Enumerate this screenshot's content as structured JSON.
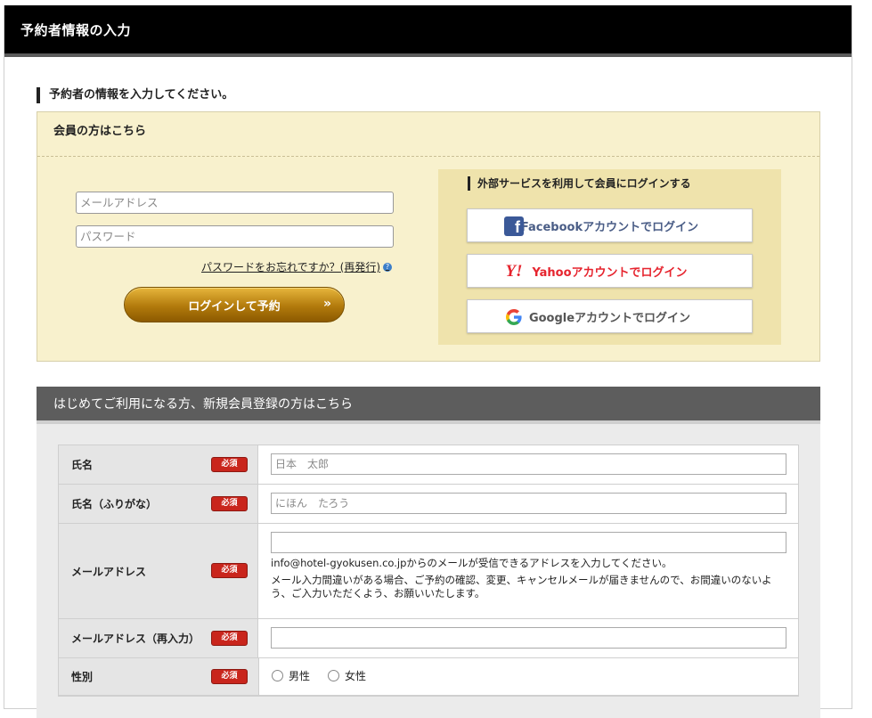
{
  "header": {
    "title": "予約者情報の入力"
  },
  "intro": {
    "heading": "予約者の情報を入力してください。"
  },
  "member_login": {
    "title": "会員の方はこちら",
    "email_placeholder": "メールアドレス",
    "password_placeholder": "パスワード",
    "forgot_link": "パスワードをお忘れですか？(再発行)",
    "help_icon": "?",
    "login_button": "ログインして予約",
    "login_button_icon": "»"
  },
  "external_login": {
    "title": "外部サービスを利用して会員にログインする",
    "facebook": {
      "label": "Facebookアカウントでログイン",
      "icon": "facebook-icon",
      "icon_text": "f",
      "color": "#4a5d86"
    },
    "yahoo": {
      "label": "Yahooアカウントでログイン",
      "icon": "yahoo-icon",
      "icon_text": "Y!",
      "color": "#e6242e"
    },
    "google": {
      "label": "Googleアカウントでログイン",
      "icon": "google-icon",
      "color": "#555555"
    }
  },
  "registration": {
    "title": "はじめてご利用になる方、新規会員登録の方はこちら",
    "required_badge": "必須",
    "fields": {
      "name": {
        "label": "氏名",
        "placeholder": "日本　太郎"
      },
      "name_kana": {
        "label": "氏名（ふりがな）",
        "placeholder": "にほん　たろう"
      },
      "email": {
        "label": "メールアドレス",
        "note1": "info@hotel-gyokusen.co.jpからのメールが受信できるアドレスを入力してください。",
        "note2": "メール入力間違いがある場合、ご予約の確認、変更、キャンセルメールが届きませんので、お間違いのないよう、ご入力いただくよう、お願いいたします。"
      },
      "email_confirm": {
        "label": "メールアドレス（再入力）"
      },
      "gender": {
        "label": "性別",
        "options": [
          "男性",
          "女性"
        ]
      }
    }
  },
  "colors": {
    "header_bg": "#000000",
    "member_box_bg": "#f8f1cd",
    "external_panel_bg": "#efe3ac",
    "login_button": "#b27a0c",
    "required_badge": "#c9251c"
  }
}
